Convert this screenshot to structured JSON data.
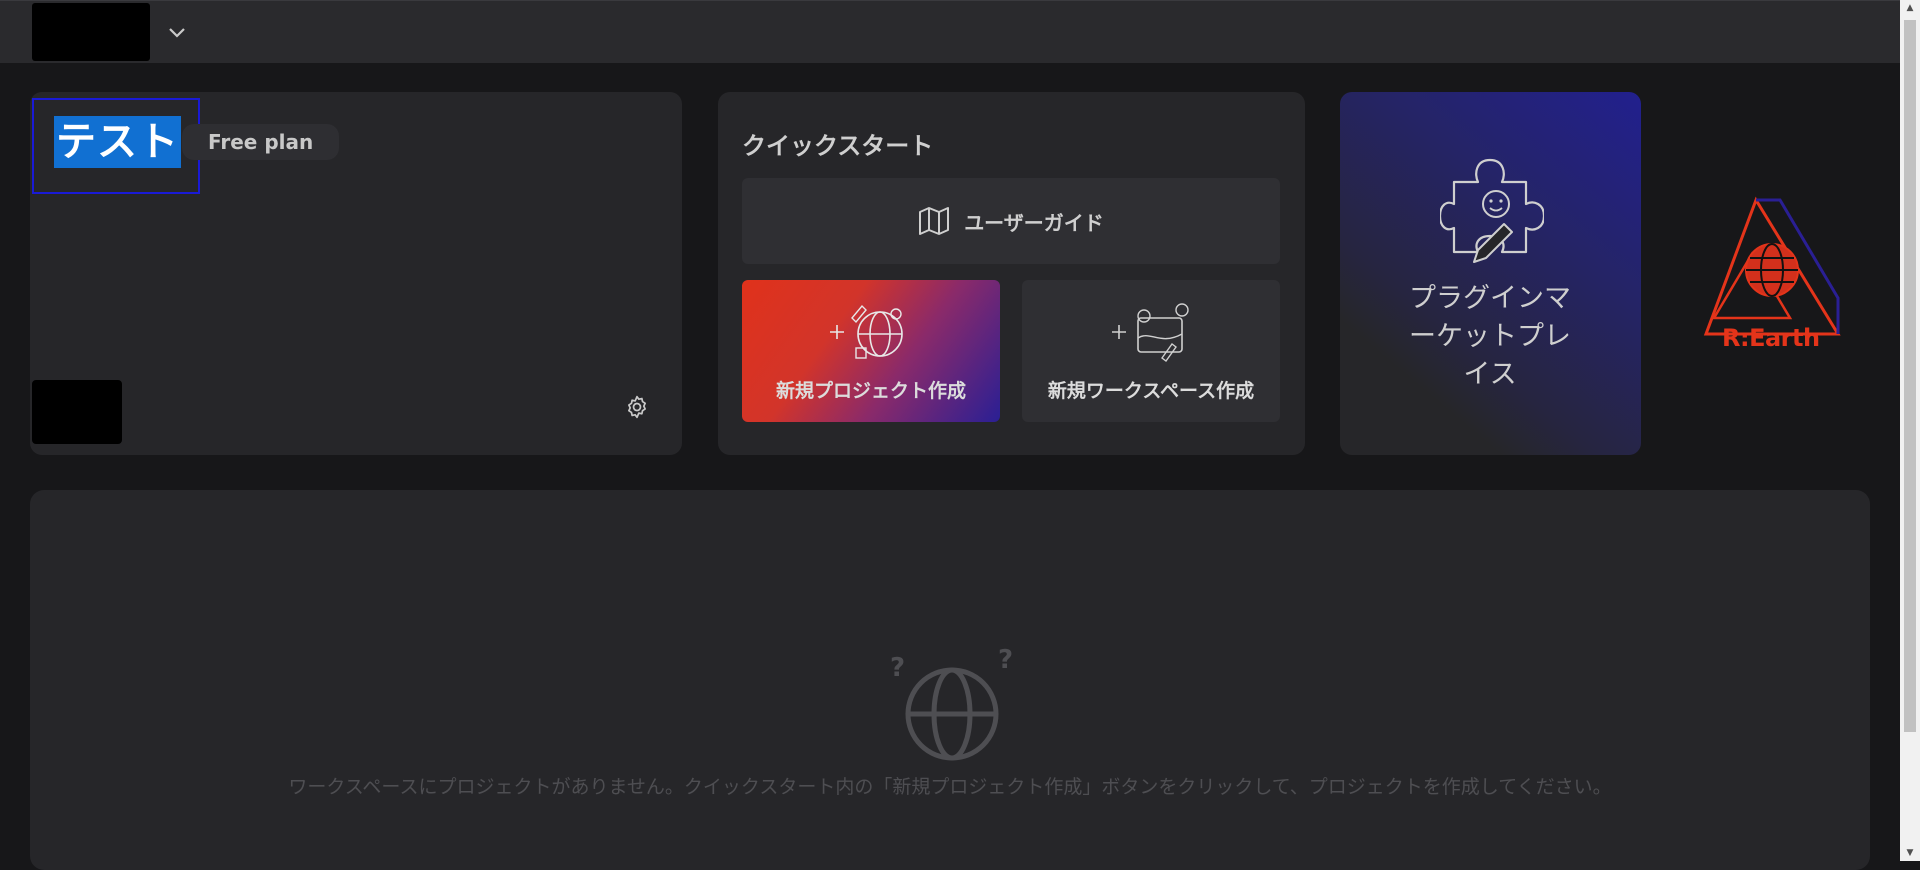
{
  "workspace": {
    "name": "テスト",
    "plan": "Free plan"
  },
  "quickstart": {
    "title": "クイックスタート",
    "user_guide_label": "ユーザーガイド",
    "new_project_label": "新規プロジェクト作成",
    "new_workspace_label": "新規ワークスペース作成"
  },
  "plugin_marketplace": {
    "label": "プラグインマーケットプレイス"
  },
  "brand": {
    "logo_text": "R:Earth",
    "accent_color": "#e4341a"
  },
  "projects": {
    "empty_message": "ワークスペースにプロジェクトがありません。クイックスタート内の「新規プロジェクト作成」ボタンをクリックして、プロジェクトを作成してください。"
  },
  "icons": {
    "workspace_menu": "chevron-down-icon",
    "settings": "gear-icon",
    "user_guide": "map-icon",
    "new_project": "globe-rocket-plus-icon",
    "new_workspace": "workspace-plus-icon",
    "plugin": "puzzle-icon",
    "empty": "globe-question-icon"
  }
}
